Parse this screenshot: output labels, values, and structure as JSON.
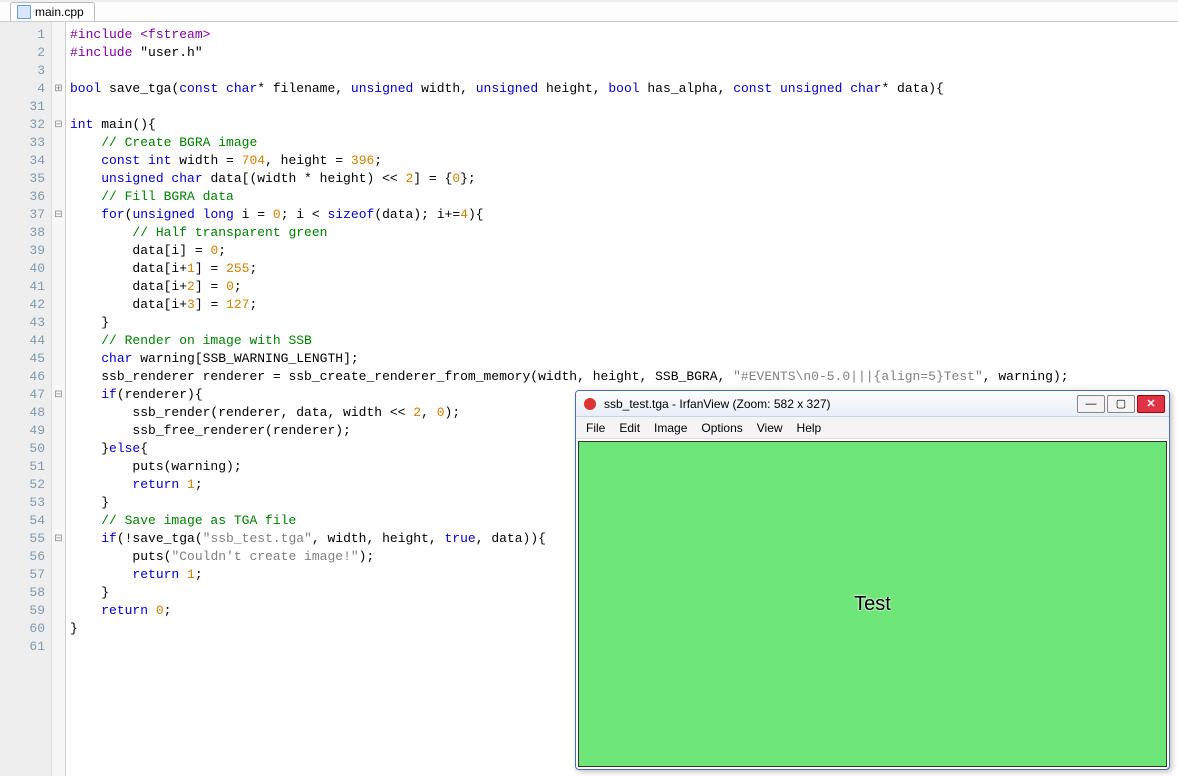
{
  "tab": {
    "filename": "main.cpp"
  },
  "colors": {
    "canvas": "#6de677"
  },
  "code": {
    "lines": [
      {
        "n": 1,
        "fold": "",
        "tokens": [
          [
            "",
            "#include <fstream>",
            "kw-purple"
          ]
        ]
      },
      {
        "n": 2,
        "fold": "",
        "tokens": [
          [
            "",
            "#include ",
            "kw-purple"
          ],
          [
            "",
            "\"user.h\"",
            "kw-orange"
          ]
        ]
      },
      {
        "n": 3,
        "fold": "",
        "tokens": [
          [
            "",
            "",
            ""
          ]
        ]
      },
      {
        "n": 4,
        "fold": "plus",
        "tokens": [
          [
            "",
            "bool ",
            "kw-blue"
          ],
          [
            "",
            "save_tga",
            ""
          ],
          [
            "",
            "(",
            ""
          ],
          [
            "",
            "const char",
            "kw-blue"
          ],
          [
            "",
            "* filename, ",
            ""
          ],
          [
            "",
            "unsigned ",
            "kw-blue"
          ],
          [
            "",
            "width, ",
            ""
          ],
          [
            "",
            "unsigned ",
            "kw-blue"
          ],
          [
            "",
            "height, ",
            ""
          ],
          [
            "",
            "bool ",
            "kw-blue"
          ],
          [
            "",
            "has_alpha, ",
            ""
          ],
          [
            "",
            "const unsigned char",
            "kw-blue"
          ],
          [
            "",
            "* data){",
            ""
          ]
        ]
      },
      {
        "n": 31,
        "fold": "",
        "tokens": [
          [
            "",
            "",
            ""
          ]
        ]
      },
      {
        "n": 32,
        "fold": "minus",
        "tokens": [
          [
            "",
            "int ",
            "kw-blue"
          ],
          [
            "",
            "main",
            ""
          ],
          [
            "",
            "(){",
            ""
          ]
        ]
      },
      {
        "n": 33,
        "fold": "",
        "tokens": [
          [
            "    ",
            "// Create BGRA image",
            "cm-green"
          ]
        ]
      },
      {
        "n": 34,
        "fold": "",
        "tokens": [
          [
            "    ",
            "const int ",
            "kw-blue"
          ],
          [
            "",
            "width = ",
            ""
          ],
          [
            "",
            "704",
            "num-orange"
          ],
          [
            "",
            ", height = ",
            ""
          ],
          [
            "",
            "396",
            "num-orange"
          ],
          [
            "",
            ";",
            ""
          ]
        ]
      },
      {
        "n": 35,
        "fold": "",
        "tokens": [
          [
            "    ",
            "unsigned char ",
            "kw-blue"
          ],
          [
            "",
            "data[(width * height) << ",
            ""
          ],
          [
            "",
            "2",
            "num-orange"
          ],
          [
            "",
            "] = {",
            ""
          ],
          [
            "",
            "0",
            "num-orange"
          ],
          [
            "",
            "};",
            ""
          ]
        ]
      },
      {
        "n": 36,
        "fold": "",
        "tokens": [
          [
            "    ",
            "// Fill BGRA data",
            "cm-green"
          ]
        ]
      },
      {
        "n": 37,
        "fold": "minus",
        "tokens": [
          [
            "    ",
            "for",
            "kw-blue"
          ],
          [
            "",
            "(",
            ""
          ],
          [
            "",
            "unsigned long ",
            "kw-blue"
          ],
          [
            "",
            "i = ",
            ""
          ],
          [
            "",
            "0",
            "num-orange"
          ],
          [
            "",
            "; i < ",
            ""
          ],
          [
            "",
            "sizeof",
            "kw-blue"
          ],
          [
            "",
            "(data); i+=",
            ""
          ],
          [
            "",
            "4",
            "num-orange"
          ],
          [
            "",
            "){",
            ""
          ]
        ]
      },
      {
        "n": 38,
        "fold": "",
        "tokens": [
          [
            "        ",
            "// Half transparent green",
            "cm-green"
          ]
        ]
      },
      {
        "n": 39,
        "fold": "",
        "tokens": [
          [
            "        ",
            "data[i] = ",
            ""
          ],
          [
            "",
            "0",
            "num-orange"
          ],
          [
            "",
            ";",
            ""
          ]
        ]
      },
      {
        "n": 40,
        "fold": "",
        "tokens": [
          [
            "        ",
            "data[i+",
            ""
          ],
          [
            "",
            "1",
            "num-orange"
          ],
          [
            "",
            "] = ",
            ""
          ],
          [
            "",
            "255",
            "num-orange"
          ],
          [
            "",
            ";",
            ""
          ]
        ]
      },
      {
        "n": 41,
        "fold": "",
        "tokens": [
          [
            "        ",
            "data[i+",
            ""
          ],
          [
            "",
            "2",
            "num-orange"
          ],
          [
            "",
            "] = ",
            ""
          ],
          [
            "",
            "0",
            "num-orange"
          ],
          [
            "",
            ";",
            ""
          ]
        ]
      },
      {
        "n": 42,
        "fold": "",
        "tokens": [
          [
            "        ",
            "data[i+",
            ""
          ],
          [
            "",
            "3",
            "num-orange"
          ],
          [
            "",
            "] = ",
            ""
          ],
          [
            "",
            "127",
            "num-orange"
          ],
          [
            "",
            ";",
            ""
          ]
        ]
      },
      {
        "n": 43,
        "fold": "",
        "tokens": [
          [
            "    ",
            "}",
            ""
          ]
        ]
      },
      {
        "n": 44,
        "fold": "",
        "tokens": [
          [
            "    ",
            "// Render on image with SSB",
            "cm-green"
          ]
        ]
      },
      {
        "n": 45,
        "fold": "",
        "tokens": [
          [
            "    ",
            "char ",
            "kw-blue"
          ],
          [
            "",
            "warning[SSB_WARNING_LENGTH];",
            ""
          ]
        ]
      },
      {
        "n": 46,
        "fold": "",
        "tokens": [
          [
            "    ",
            "ssb_renderer renderer = ssb_create_renderer_from_memory(width, height, SSB_BGRA, ",
            ""
          ],
          [
            "",
            "\"#EVENTS\\n0-5.0|||{align=5}Test\"",
            "str-gray"
          ],
          [
            "",
            ", warning);",
            ""
          ]
        ]
      },
      {
        "n": 47,
        "fold": "minus",
        "tokens": [
          [
            "    ",
            "if",
            "kw-blue"
          ],
          [
            "",
            "(renderer){",
            ""
          ]
        ]
      },
      {
        "n": 48,
        "fold": "",
        "tokens": [
          [
            "        ",
            "ssb_render(renderer, data, width << ",
            ""
          ],
          [
            "",
            "2",
            "num-orange"
          ],
          [
            "",
            ", ",
            ""
          ],
          [
            "",
            "0",
            "num-orange"
          ],
          [
            "",
            ");",
            ""
          ]
        ]
      },
      {
        "n": 49,
        "fold": "",
        "tokens": [
          [
            "        ",
            "ssb_free_renderer(renderer);",
            ""
          ]
        ]
      },
      {
        "n": 50,
        "fold": "",
        "tokens": [
          [
            "    ",
            "}",
            ""
          ],
          [
            "",
            "else",
            "kw-blue"
          ],
          [
            "",
            "{",
            ""
          ]
        ]
      },
      {
        "n": 51,
        "fold": "",
        "tokens": [
          [
            "        ",
            "puts(warning);",
            ""
          ]
        ]
      },
      {
        "n": 52,
        "fold": "",
        "tokens": [
          [
            "        ",
            "return ",
            "kw-blue"
          ],
          [
            "",
            "1",
            "num-orange"
          ],
          [
            "",
            ";",
            ""
          ]
        ]
      },
      {
        "n": 53,
        "fold": "",
        "tokens": [
          [
            "    ",
            "}",
            ""
          ]
        ]
      },
      {
        "n": 54,
        "fold": "",
        "tokens": [
          [
            "    ",
            "// Save image as TGA file",
            "cm-green"
          ]
        ]
      },
      {
        "n": 55,
        "fold": "minus",
        "tokens": [
          [
            "    ",
            "if",
            "kw-blue"
          ],
          [
            "",
            "(!save_tga(",
            ""
          ],
          [
            "",
            "\"ssb_test.tga\"",
            "str-gray"
          ],
          [
            "",
            ", width, height, ",
            ""
          ],
          [
            "",
            "true",
            "kw-blue"
          ],
          [
            "",
            ", data)){",
            ""
          ]
        ]
      },
      {
        "n": 56,
        "fold": "",
        "tokens": [
          [
            "        ",
            "puts(",
            ""
          ],
          [
            "",
            "\"Couldn't create image!\"",
            "str-gray"
          ],
          [
            "",
            ");",
            ""
          ]
        ]
      },
      {
        "n": 57,
        "fold": "",
        "tokens": [
          [
            "        ",
            "return ",
            "kw-blue"
          ],
          [
            "",
            "1",
            "num-orange"
          ],
          [
            "",
            ";",
            ""
          ]
        ]
      },
      {
        "n": 58,
        "fold": "",
        "tokens": [
          [
            "    ",
            "}",
            ""
          ]
        ]
      },
      {
        "n": 59,
        "fold": "",
        "tokens": [
          [
            "    ",
            "return ",
            "kw-blue"
          ],
          [
            "",
            "0",
            "num-orange"
          ],
          [
            "",
            ";",
            ""
          ]
        ]
      },
      {
        "n": 60,
        "fold": "",
        "tokens": [
          [
            "",
            "}",
            ""
          ]
        ]
      },
      {
        "n": 61,
        "fold": "",
        "tokens": [
          [
            "",
            "",
            ""
          ]
        ]
      }
    ]
  },
  "irfan": {
    "title": "ssb_test.tga - IrfanView (Zoom: 582 x 327)",
    "menu": [
      "File",
      "Edit",
      "Image",
      "Options",
      "View",
      "Help"
    ],
    "canvas_text": "Test"
  }
}
